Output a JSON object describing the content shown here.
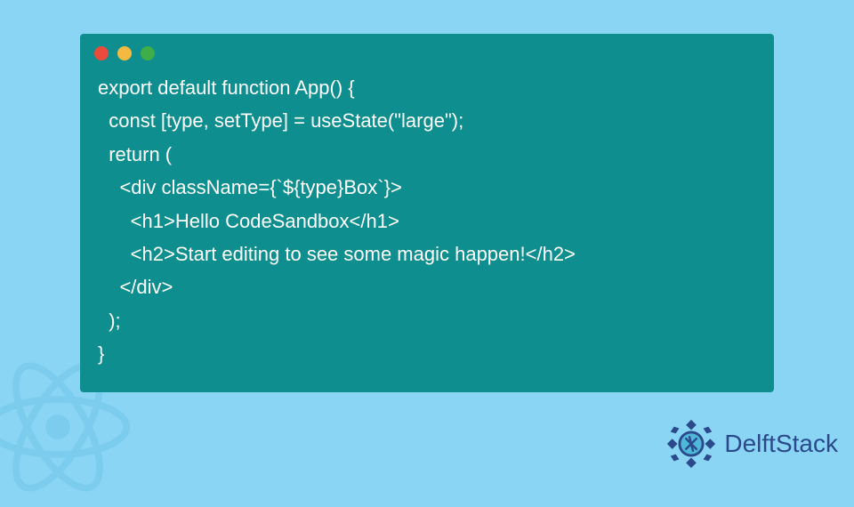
{
  "code": {
    "lines": [
      "export default function App() {",
      "  const [type, setType] = useState(\"large\");",
      "  return (",
      "    <div className={`${type}Box`}>",
      "      <h1>Hello CodeSandbox</h1>",
      "      <h2>Start editing to see some magic happen!</h2>",
      "    </div>",
      "  );",
      "}"
    ]
  },
  "window": {
    "dot_colors": {
      "red": "#e94b3c",
      "yellow": "#f4b940",
      "green": "#3fae49"
    }
  },
  "brand": {
    "name": "DelftStack"
  }
}
